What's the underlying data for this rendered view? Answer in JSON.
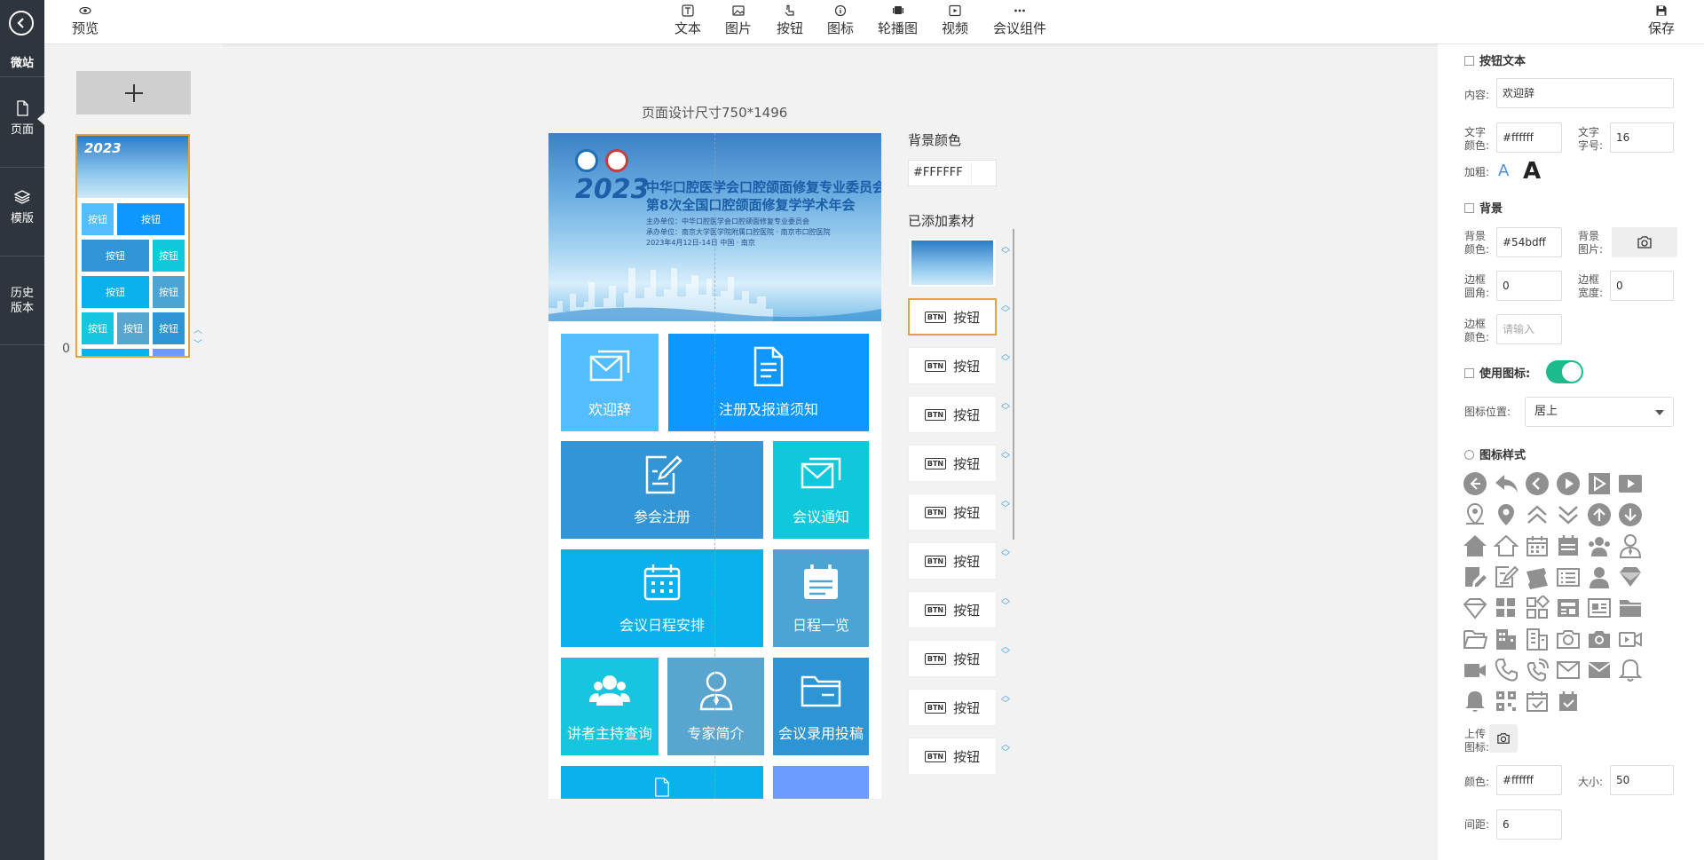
{
  "leftnav": {
    "brand": "微站",
    "items": [
      {
        "label": "页面",
        "icon": "page-icon"
      },
      {
        "label": "模版",
        "icon": "layers-icon"
      },
      {
        "label": "历史版本",
        "icon": "history-icon"
      }
    ]
  },
  "toolbar": {
    "preview": "预览",
    "save": "保存",
    "items": [
      {
        "label": "文本",
        "icon": "text-icon"
      },
      {
        "label": "图片",
        "icon": "image-icon"
      },
      {
        "label": "按钮",
        "icon": "button-icon"
      },
      {
        "label": "图标",
        "icon": "info-icon"
      },
      {
        "label": "轮播图",
        "icon": "carousel-icon"
      },
      {
        "label": "视频",
        "icon": "video-icon"
      },
      {
        "label": "会议组件",
        "icon": "more-icon"
      }
    ]
  },
  "pages": {
    "index": "0",
    "thumb": {
      "year": "2023",
      "buttons": [
        "按钮",
        "按钮",
        "按钮",
        "按钮",
        "按钮",
        "按钮",
        "按钮",
        "按钮",
        "按钮"
      ]
    }
  },
  "canvas": {
    "size_label": "页面设计尺寸750*1496",
    "banner": {
      "year": "2023",
      "title1": "中华口腔医学会口腔颌面修复专业委员会",
      "title2": "第8次全国口腔颌面修复学学术年会",
      "sub1": "主办单位：中华口腔医学会口腔颌面修复专业委员会",
      "sub2": "承办单位：南京大学医学院附属口腔医院 · 南京市口腔医院",
      "date": "2023年4月12日-14日  中国 · 南京"
    },
    "tiles": [
      {
        "label": "欢迎辞",
        "color": "#54bdff",
        "icon": "mail-icon"
      },
      {
        "label": "注册及报道须知",
        "color": "#0d97ff",
        "icon": "document-icon"
      },
      {
        "label": "参会注册",
        "color": "#3296d6",
        "icon": "edit-icon"
      },
      {
        "label": "会议通知",
        "color": "#0fc8db",
        "icon": "mail-icon"
      },
      {
        "label": "会议日程安排",
        "color": "#0ab1ec",
        "icon": "calendar-icon"
      },
      {
        "label": "日程一览",
        "color": "#4ba4d4",
        "icon": "schedule-icon"
      },
      {
        "label": "讲者主持查询",
        "color": "#16c6df",
        "icon": "users-icon"
      },
      {
        "label": "专家简介",
        "color": "#58a6cf",
        "icon": "expert-icon"
      },
      {
        "label": "会议录用投稿",
        "color": "#2d95d4",
        "icon": "folder-icon"
      }
    ]
  },
  "assets": {
    "bg_label": "背景颜色",
    "bg_color": "#FFFFFF",
    "added_label": "已添加素材",
    "btn_badge": "BTN",
    "items": [
      "按钮",
      "按钮",
      "按钮",
      "按钮",
      "按钮",
      "按钮",
      "按钮",
      "按钮",
      "按钮",
      "按钮"
    ]
  },
  "panel": {
    "sec_button_text": "按钮文本",
    "content_label": "内容:",
    "content_value": "欢迎辞",
    "text_color_label": "文字颜色:",
    "text_color_value": "#ffffff",
    "font_size_label": "文字字号:",
    "font_size_value": "16",
    "bold_label": "加粗:",
    "bold_a": "A",
    "sec_background": "背景",
    "bg_color_label": "背景颜色:",
    "bg_color_value": "#54bdff",
    "bg_image_label": "背景图片:",
    "radius_label": "边框圆角:",
    "radius_value": "0",
    "border_width_label": "边框宽度:",
    "border_width_value": "0",
    "border_color_label": "边框颜色:",
    "border_color_placeholder": "请输入",
    "use_icon_label": "使用图标:",
    "icon_pos_label": "图标位置:",
    "icon_pos_value": "居上",
    "icon_style_label": "图标样式",
    "upload_icon_label": "上传图标:",
    "icon_color_label": "颜色:",
    "icon_color_value": "#ffffff",
    "icon_size_label": "大小:",
    "icon_size_value": "50",
    "spacing_label": "间距:",
    "spacing_value": "6"
  }
}
